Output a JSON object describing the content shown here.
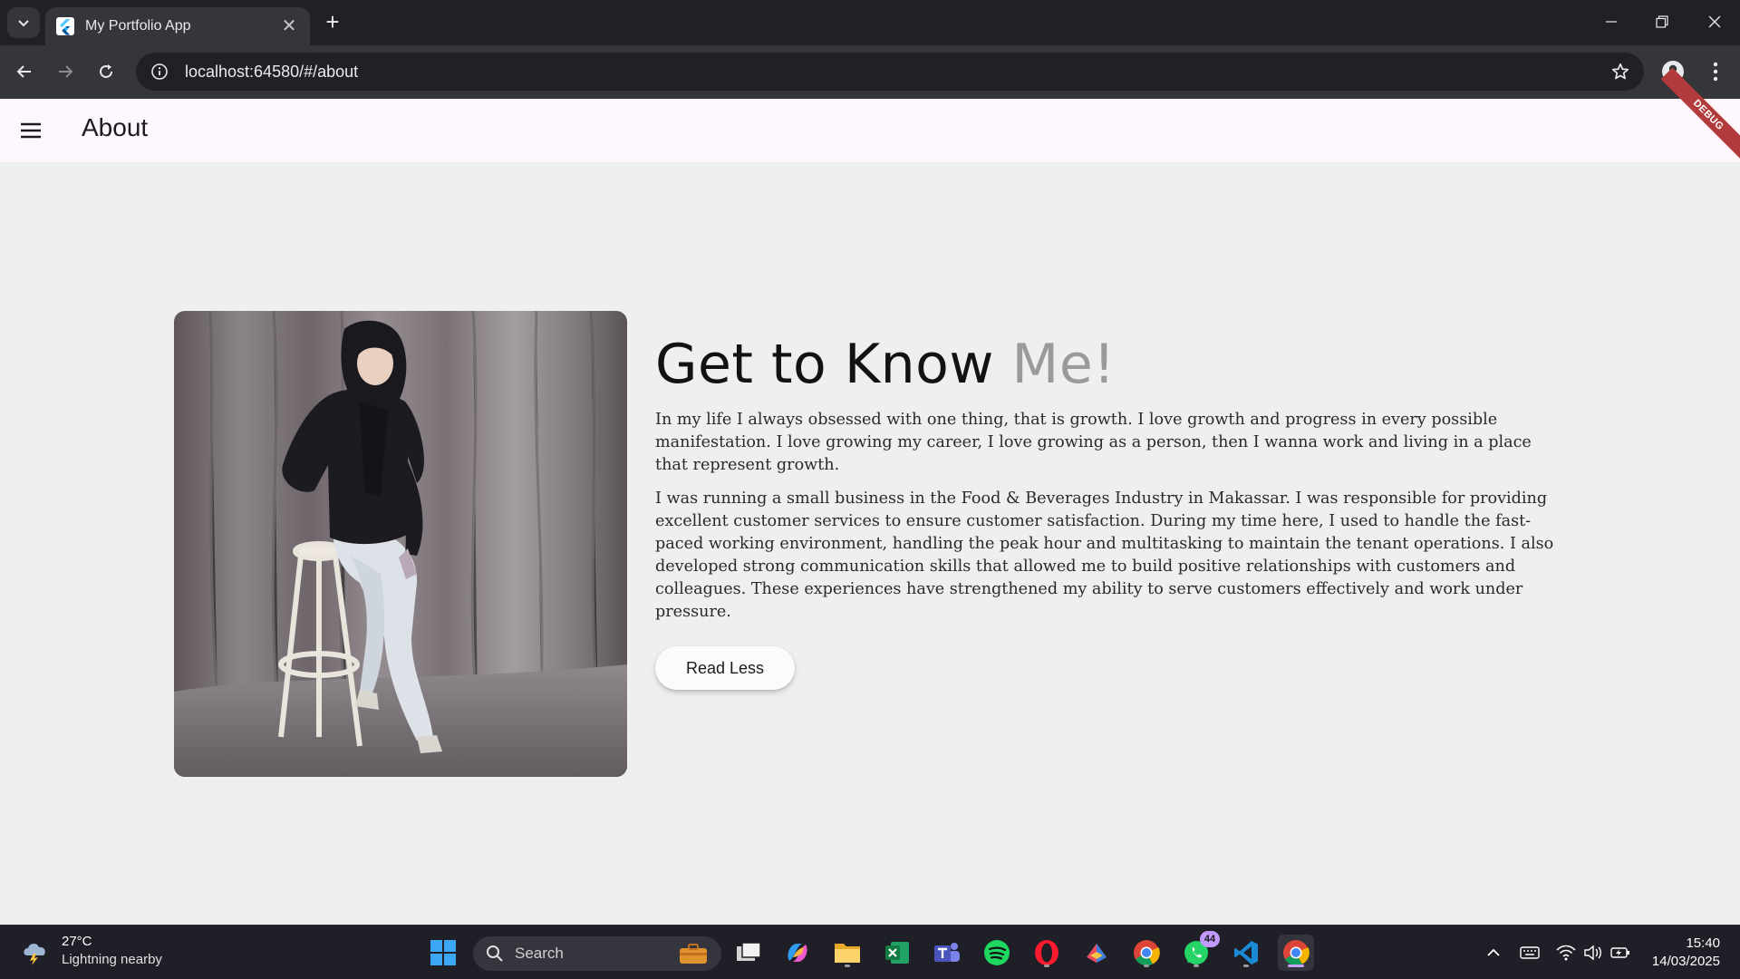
{
  "browser": {
    "tab_title": "My Portfolio App",
    "url": "localhost:64580/#/about"
  },
  "app": {
    "title": "About",
    "debug_label": "DEBUG"
  },
  "about": {
    "heading_main": "Get to Know ",
    "heading_accent": "Me!",
    "paragraphs": [
      "In my life I always obsessed with one thing, that is growth. I love growth and progress in every possible manifestation. I love growing my career, I love growing as a person, then I wanna work and living in a place that represent growth.",
      "I was running a small business in the Food & Beverages Industry in Makassar. I was responsible for providing excellent customer services to ensure customer satisfaction. During my time here, I used to handle the fast-paced working environment, handling the peak hour and multitasking to maintain the tenant operations. I also developed strong communication skills that allowed me to build positive relationships with customers and colleagues. These experiences have strengthened my ability to serve customers effectively and work under pressure."
    ],
    "button_label": "Read Less"
  },
  "taskbar": {
    "weather_temp": "27°C",
    "weather_desc": "Lightning nearby",
    "search_label": "Search",
    "whatsapp_badge": "44",
    "time": "15:40",
    "date": "14/03/2025"
  },
  "colors": {
    "accent_heading": "#9a9a9a",
    "appbar_bg": "#fdf7fd",
    "debug_banner": "#b23b3b"
  }
}
